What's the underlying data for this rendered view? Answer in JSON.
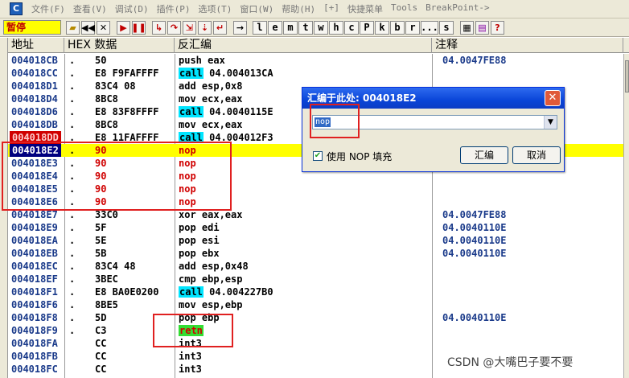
{
  "menu": [
    "文件(F)",
    "查看(V)",
    "调试(D)",
    "插件(P)",
    "选项(T)",
    "窗口(W)",
    "帮助(H)",
    "[+]",
    "快捷菜单",
    "Tools",
    "BreakPoint->"
  ],
  "toolbar": {
    "status": "暂停",
    "letters": [
      "l",
      "e",
      "m",
      "t",
      "w",
      "h",
      "c",
      "P",
      "k",
      "b",
      "r",
      "...",
      "s"
    ]
  },
  "columns": [
    "地址",
    "HEX 数据",
    "反汇编",
    "注释"
  ],
  "rows": [
    {
      "addr": "004018CB",
      "dot": ".",
      "hex": "50",
      "dis": "push eax",
      "cmt": "04.0047FE88"
    },
    {
      "addr": "004018CC",
      "dot": ".",
      "hex": "E8 F9FAFFFF",
      "call": "call",
      "dis": " 04.004013CA",
      "cmt": ""
    },
    {
      "addr": "004018D1",
      "dot": ".",
      "hex": "83C4 08",
      "dis": "add esp,0x8",
      "cmt": ""
    },
    {
      "addr": "004018D4",
      "dot": ".",
      "hex": "8BC8",
      "dis": "mov ecx,eax",
      "cmt": ""
    },
    {
      "addr": "004018D6",
      "dot": ".",
      "hex": "E8 83F8FFFF",
      "call": "call",
      "dis": " 04.0040115E",
      "cmt": ""
    },
    {
      "addr": "004018DB",
      "dot": ".",
      "hex": "8BC8",
      "dis": "mov ecx,eax",
      "cmt": ""
    },
    {
      "addr": "004018DD",
      "dot": ".",
      "hex": "E8 11FAFFFF",
      "call": "call",
      "dis": " 04.004012F3",
      "cmt": ""
    },
    {
      "addr": "004018E2",
      "dot": ".",
      "hex": "90",
      "dis": "nop",
      "cmt": ""
    },
    {
      "addr": "004018E3",
      "dot": ".",
      "hex": "90",
      "dis": "nop",
      "cmt": ""
    },
    {
      "addr": "004018E4",
      "dot": ".",
      "hex": "90",
      "dis": "nop",
      "cmt": ""
    },
    {
      "addr": "004018E5",
      "dot": ".",
      "hex": "90",
      "dis": "nop",
      "cmt": ""
    },
    {
      "addr": "004018E6",
      "dot": ".",
      "hex": "90",
      "dis": "nop",
      "cmt": ""
    },
    {
      "addr": "004018E7",
      "dot": ".",
      "hex": "33C0",
      "dis": "xor eax,eax",
      "cmt": "04.0047FE88"
    },
    {
      "addr": "004018E9",
      "dot": ".",
      "hex": "5F",
      "dis": "pop edi",
      "cmt": "04.0040110E"
    },
    {
      "addr": "004018EA",
      "dot": ".",
      "hex": "5E",
      "dis": "pop esi",
      "cmt": "04.0040110E"
    },
    {
      "addr": "004018EB",
      "dot": ".",
      "hex": "5B",
      "dis": "pop ebx",
      "cmt": "04.0040110E"
    },
    {
      "addr": "004018EC",
      "dot": ".",
      "hex": "83C4 48",
      "dis": "add esp,0x48",
      "cmt": ""
    },
    {
      "addr": "004018EF",
      "dot": ".",
      "hex": "3BEC",
      "dis": "cmp ebp,esp",
      "cmt": ""
    },
    {
      "addr": "004018F1",
      "dot": ".",
      "hex": "E8 BA0E0200",
      "call": "call",
      "dis": " 04.004227B0",
      "cmt": ""
    },
    {
      "addr": "004018F6",
      "dot": ".",
      "hex": "8BE5",
      "dis": "mov esp,ebp",
      "cmt": ""
    },
    {
      "addr": "004018F8",
      "dot": ".",
      "hex": "5D",
      "dis": "pop ebp",
      "cmt": "04.0040110E"
    },
    {
      "addr": "004018F9",
      "dot": ".",
      "hex": "C3",
      "retn": "retn",
      "dis": "",
      "cmt": ""
    },
    {
      "addr": "004018FA",
      "dot": "",
      "hex": "CC",
      "dis": "int3",
      "cmt": ""
    },
    {
      "addr": "004018FB",
      "dot": "",
      "hex": "CC",
      "dis": "int3",
      "cmt": ""
    },
    {
      "addr": "004018FC",
      "dot": "",
      "hex": "CC",
      "dis": "int3",
      "cmt": ""
    }
  ],
  "dialog": {
    "title": "汇编于此处: 004018E2",
    "input": "nop",
    "checkbox_label": "使用 NOP 填充",
    "ok": "汇编",
    "cancel": "取消"
  },
  "watermark": "CSDN @大嘴巴子要不要"
}
